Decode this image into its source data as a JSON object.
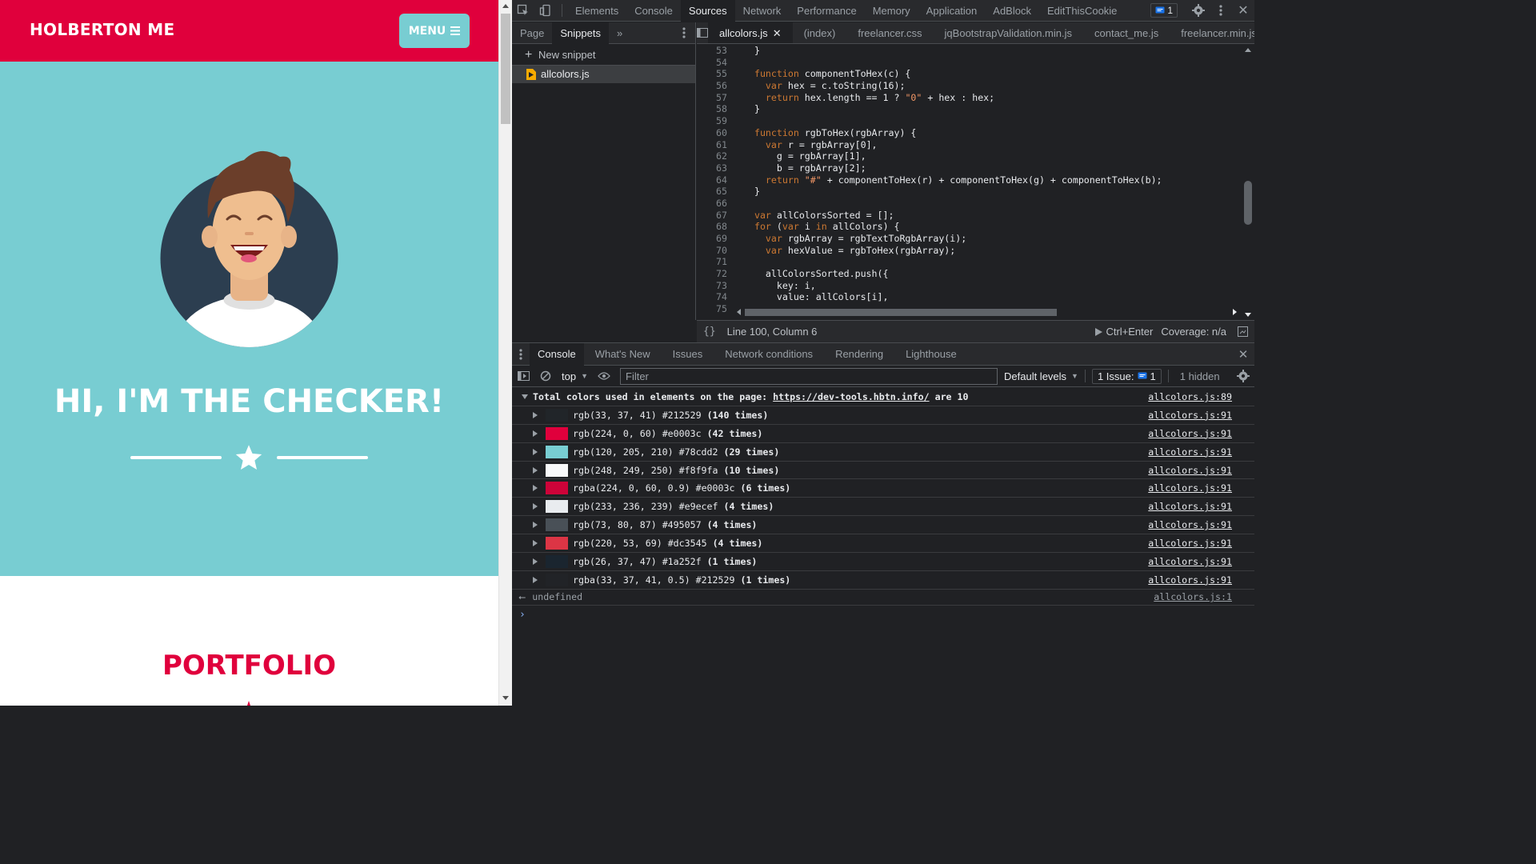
{
  "site": {
    "brand": "HOLBERTON ME",
    "menu_label": "MENU",
    "masthead_title": "HI, I'M THE CHECKER!",
    "portfolio_title": "PORTFOLIO",
    "colors": {
      "primary": "#e0003c",
      "secondary": "#78cdd2",
      "avatar_bg": "#2c3e50"
    }
  },
  "devtools": {
    "main_tabs": [
      "Elements",
      "Console",
      "Sources",
      "Network",
      "Performance",
      "Memory",
      "Application",
      "AdBlock",
      "EditThisCookie"
    ],
    "active_main_tab": "Sources",
    "issues_badge": "1",
    "navigator_tabs": [
      "Page",
      "Snippets"
    ],
    "new_snippet_label": "New snippet",
    "snippet_file": "allcolors.js",
    "editor_tabs": [
      "allcolors.js",
      "(index)",
      "freelancer.css",
      "jqBootstrapValidation.min.js",
      "contact_me.js",
      "freelancer.min.js"
    ],
    "code_lines": [
      {
        "n": "53",
        "t": "  }"
      },
      {
        "n": "54",
        "t": ""
      },
      {
        "n": "55",
        "t": "  function componentToHex(c) {"
      },
      {
        "n": "56",
        "t": "    var hex = c.toString(16);"
      },
      {
        "n": "57",
        "t": "    return hex.length == 1 ? \"0\" + hex : hex;"
      },
      {
        "n": "58",
        "t": "  }"
      },
      {
        "n": "59",
        "t": ""
      },
      {
        "n": "60",
        "t": "  function rgbToHex(rgbArray) {"
      },
      {
        "n": "61",
        "t": "    var r = rgbArray[0],"
      },
      {
        "n": "62",
        "t": "      g = rgbArray[1],"
      },
      {
        "n": "63",
        "t": "      b = rgbArray[2];"
      },
      {
        "n": "64",
        "t": "    return \"#\" + componentToHex(r) + componentToHex(g) + componentToHex(b);"
      },
      {
        "n": "65",
        "t": "  }"
      },
      {
        "n": "66",
        "t": ""
      },
      {
        "n": "67",
        "t": "  var allColorsSorted = [];"
      },
      {
        "n": "68",
        "t": "  for (var i in allColors) {"
      },
      {
        "n": "69",
        "t": "    var rgbArray = rgbTextToRgbArray(i);"
      },
      {
        "n": "70",
        "t": "    var hexValue = rgbToHex(rgbArray);"
      },
      {
        "n": "71",
        "t": ""
      },
      {
        "n": "72",
        "t": "    allColorsSorted.push({"
      },
      {
        "n": "73",
        "t": "      key: i,"
      },
      {
        "n": "74",
        "t": "      value: allColors[i],"
      },
      {
        "n": "75",
        "t": ""
      }
    ],
    "status_position": "Line 100, Column 6",
    "run_shortcut": "Ctrl+Enter",
    "coverage": "Coverage: n/a",
    "drawer_tabs": [
      "Console",
      "What's New",
      "Issues",
      "Network conditions",
      "Rendering",
      "Lighthouse"
    ],
    "context": "top",
    "filter_placeholder": "Filter",
    "default_levels": "Default levels",
    "issues_label": "1 Issue:",
    "issues_count": "1",
    "hidden_label": "1 hidden",
    "summary": {
      "prefix": "Total colors used in elements on the page: ",
      "url": "https://dev-tools.hbtn.info/",
      "suffix": " are 10",
      "source": "allcolors.js:89"
    },
    "color_rows": [
      {
        "color": "rgb(33, 37, 41)",
        "hex": "#212529",
        "count": "(140 times)",
        "swatch": "#212529",
        "source": "allcolors.js:91"
      },
      {
        "color": "rgb(224, 0, 60)",
        "hex": "#e0003c",
        "count": "(42 times)",
        "swatch": "#e0003c",
        "source": "allcolors.js:91"
      },
      {
        "color": "rgb(120, 205, 210)",
        "hex": "#78cdd2",
        "count": "(29 times)",
        "swatch": "#78cdd2",
        "source": "allcolors.js:91"
      },
      {
        "color": "rgb(248, 249, 250)",
        "hex": "#f8f9fa",
        "count": "(10 times)",
        "swatch": "#f8f9fa",
        "source": "allcolors.js:91"
      },
      {
        "color": "rgba(224, 0, 60, 0.9)",
        "hex": "#e0003c",
        "count": "(6 times)",
        "swatch": "rgba(224,0,60,0.9)",
        "source": "allcolors.js:91"
      },
      {
        "color": "rgb(233, 236, 239)",
        "hex": "#e9ecef",
        "count": "(4 times)",
        "swatch": "#e9ecef",
        "source": "allcolors.js:91"
      },
      {
        "color": "rgb(73, 80, 87)",
        "hex": "#495057",
        "count": "(4 times)",
        "swatch": "#495057",
        "source": "allcolors.js:91"
      },
      {
        "color": "rgb(220, 53, 69)",
        "hex": "#dc3545",
        "count": "(4 times)",
        "swatch": "#dc3545",
        "source": "allcolors.js:91"
      },
      {
        "color": "rgb(26, 37, 47)",
        "hex": "#1a252f",
        "count": "(1 times)",
        "swatch": "#1a252f",
        "source": "allcolors.js:91"
      },
      {
        "color": "rgba(33, 37, 41, 0.5)",
        "hex": "#212529",
        "count": "(1 times)",
        "swatch": "rgba(33,37,41,0.5)",
        "source": "allcolors.js:91"
      }
    ],
    "return_value": "undefined",
    "return_source": "allcolors.js:1"
  }
}
